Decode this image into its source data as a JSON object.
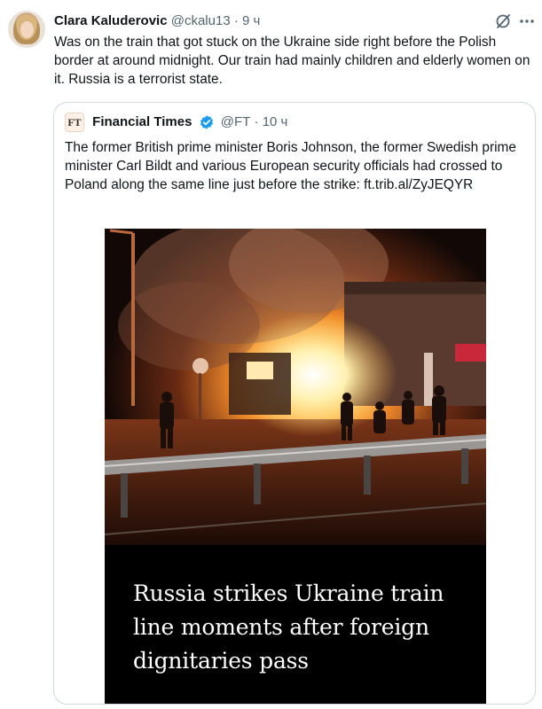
{
  "tweet": {
    "author_name": "Clara Kaluderovic",
    "handle": "@ckalu13",
    "separator": "·",
    "time": "9 ч",
    "text": "Was on the train that got stuck on the Ukraine side right before the Polish border at around midnight. Our train had mainly children and elderly women on it. Russia is a terrorist state.",
    "icons": {
      "grok": "grok-icon",
      "more": "more-icon"
    }
  },
  "quoted": {
    "logo_text": "FT",
    "author_name": "Financial Times",
    "handle": "@FT",
    "separator": "·",
    "time": "10 ч",
    "text": "The former British prime minister Boris Johnson, the former Swedish prime minister Carl Bildt and various European security officials had crossed to Poland along the same line just before the strike:",
    "link": "ft.trib.al/ZyJEQYR",
    "verified_color": "#1d9bf0",
    "media": {
      "headline": "Russia strikes Ukraine train line moments after foreign dignitaries pass"
    }
  }
}
